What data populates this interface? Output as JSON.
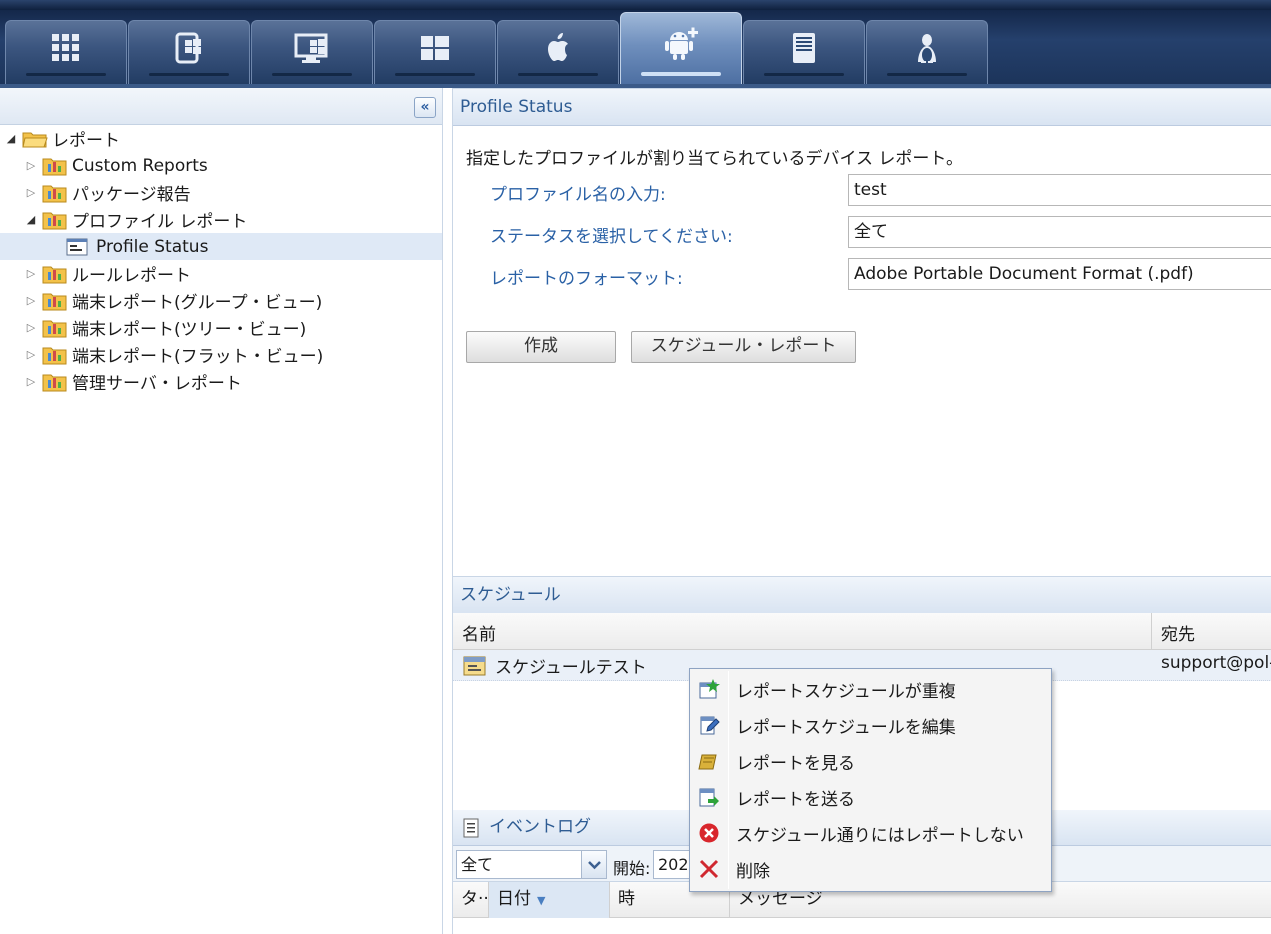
{
  "toolbar": {
    "tabs": [
      {
        "icon": "grid-icon"
      },
      {
        "icon": "windows-mobile-icon"
      },
      {
        "icon": "windows-desktop-icon"
      },
      {
        "icon": "windows-icon"
      },
      {
        "icon": "apple-icon"
      },
      {
        "icon": "android-icon",
        "active": true
      },
      {
        "icon": "server-icon"
      },
      {
        "icon": "linux-icon"
      }
    ]
  },
  "left_panel": {
    "collapse_glyph": "«",
    "tree": [
      {
        "label": "レポート",
        "level": 0,
        "expanded": true
      },
      {
        "label": "Custom Reports",
        "level": 1
      },
      {
        "label": "パッケージ報告",
        "level": 1
      },
      {
        "label": "プロファイル レポート",
        "level": 1,
        "expanded": true
      },
      {
        "label": "Profile Status",
        "level": 2,
        "selected": true
      },
      {
        "label": "ルールレポート",
        "level": 1
      },
      {
        "label": "端末レポート(グループ・ビュー)",
        "level": 1
      },
      {
        "label": "端末レポート(ツリー・ビュー)",
        "level": 1
      },
      {
        "label": "端末レポート(フラット・ビュー)",
        "level": 1
      },
      {
        "label": "管理サーバ・レポート",
        "level": 1
      }
    ]
  },
  "profile_status": {
    "title": "Profile Status",
    "description": "指定したプロファイルが割り当てられているデバイス レポート。",
    "fields": [
      {
        "label": "プロファイル名の入力:",
        "value": "test"
      },
      {
        "label": "ステータスを選択してください:",
        "value": "全て"
      },
      {
        "label": "レポートのフォーマット:",
        "value": "Adobe Portable Document Format (.pdf)"
      }
    ],
    "create_button": "作成",
    "schedule_button": "スケジュール・レポート"
  },
  "schedule": {
    "title": "スケジュール",
    "columns": [
      "名前",
      "宛先"
    ],
    "rows": [
      {
        "name": "スケジュールテスト",
        "destination": "support@pol-j"
      }
    ]
  },
  "event_log": {
    "title": "イベントログ",
    "filter_value": "全て",
    "start_label": "開始:",
    "start_value": "202",
    "columns": [
      "タ··",
      "日付",
      "時",
      "メッセージ"
    ]
  },
  "context_menu": {
    "items": [
      {
        "label": "レポートスケジュールが重複",
        "icon": "duplicate-schedule-icon"
      },
      {
        "label": "レポートスケジュールを編集",
        "icon": "edit-schedule-icon"
      },
      {
        "label": "レポートを見る",
        "icon": "view-report-icon"
      },
      {
        "label": "レポートを送る",
        "icon": "send-report-icon"
      },
      {
        "label": "スケジュール通りにはレポートしない",
        "icon": "stop-schedule-icon"
      },
      {
        "label": "削除",
        "icon": "delete-icon"
      }
    ]
  },
  "colors": {
    "toolbar_dark": "#1b3359",
    "tab_active": "#6f8fbd",
    "field_label": "#2a61a6",
    "panel_header_text": "#2e5c93",
    "selection": "#dfe9f6"
  }
}
